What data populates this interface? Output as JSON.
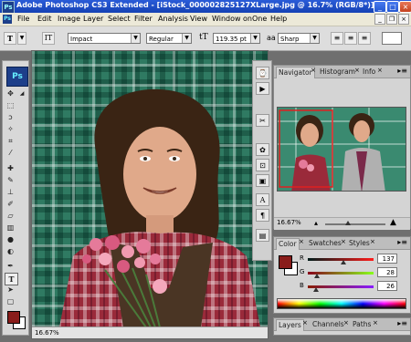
{
  "window": {
    "app_icon": "Ps",
    "title": "Adobe Photoshop CS3 Extended - [iStock_000002825127XLarge.jpg @ 16.7% (RGB/8*)]"
  },
  "menu": [
    "File",
    "Edit",
    "Image",
    "Layer",
    "Select",
    "Filter",
    "Analysis",
    "View",
    "Window",
    "onOne",
    "Help"
  ],
  "options": {
    "font_family": "Impact",
    "font_style": "Regular",
    "font_size": "119.35 pt",
    "aa_label": "aa",
    "antialias": "Sharp"
  },
  "toolbox": {
    "logo": "Ps"
  },
  "document": {
    "zoom": "16.67%"
  },
  "navigator_panel": {
    "tabs": [
      "Navigator",
      "Histogram",
      "Info"
    ],
    "zoom": "16.67%"
  },
  "color_panel": {
    "tabs": [
      "Color",
      "Swatches",
      "Styles"
    ],
    "r_label": "R",
    "g_label": "G",
    "b_label": "B",
    "r_value": "137",
    "g_value": "28",
    "b_value": "26",
    "fg_color": "#891c1a"
  },
  "layers_panel": {
    "tabs": [
      "Layers",
      "Channels",
      "Paths"
    ]
  },
  "colors": {
    "title_bar": "#1541b4",
    "accent_red": "#891c1a"
  }
}
